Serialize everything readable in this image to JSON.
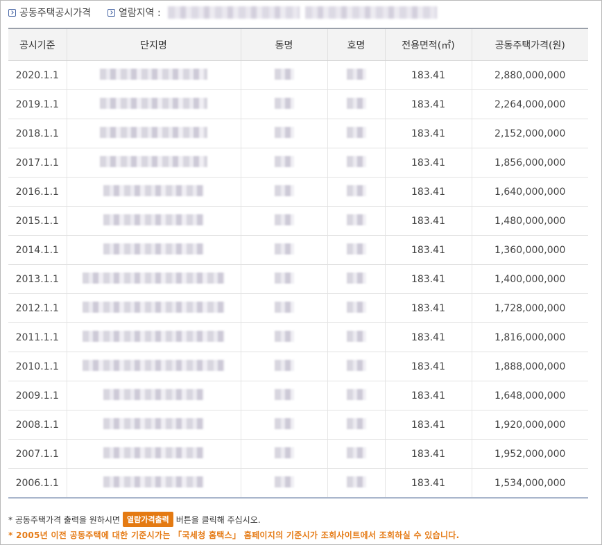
{
  "header": {
    "title": "공동주택공시가격",
    "region_label": "열람지역 :"
  },
  "table": {
    "columns": [
      "공시기준",
      "단지명",
      "동명",
      "호명",
      "전용면적(㎡)",
      "공동주택가격(원)"
    ],
    "rows": [
      {
        "date": "2020.1.1",
        "area": "183.41",
        "price": "2,880,000,000"
      },
      {
        "date": "2019.1.1",
        "area": "183.41",
        "price": "2,264,000,000"
      },
      {
        "date": "2018.1.1",
        "area": "183.41",
        "price": "2,152,000,000"
      },
      {
        "date": "2017.1.1",
        "area": "183.41",
        "price": "1,856,000,000"
      },
      {
        "date": "2016.1.1",
        "area": "183.41",
        "price": "1,640,000,000"
      },
      {
        "date": "2015.1.1",
        "area": "183.41",
        "price": "1,480,000,000"
      },
      {
        "date": "2014.1.1",
        "area": "183.41",
        "price": "1,360,000,000"
      },
      {
        "date": "2013.1.1",
        "area": "183.41",
        "price": "1,400,000,000"
      },
      {
        "date": "2012.1.1",
        "area": "183.41",
        "price": "1,728,000,000"
      },
      {
        "date": "2011.1.1",
        "area": "183.41",
        "price": "1,816,000,000"
      },
      {
        "date": "2010.1.1",
        "area": "183.41",
        "price": "1,888,000,000"
      },
      {
        "date": "2009.1.1",
        "area": "183.41",
        "price": "1,648,000,000"
      },
      {
        "date": "2008.1.1",
        "area": "183.41",
        "price": "1,920,000,000"
      },
      {
        "date": "2007.1.1",
        "area": "183.41",
        "price": "1,952,000,000"
      },
      {
        "date": "2006.1.1",
        "area": "183.41",
        "price": "1,534,000,000"
      }
    ]
  },
  "notes": {
    "print_prefix": "* 공동주택가격 출력을 원하시면",
    "print_button": "열람가격출력",
    "print_suffix": "버튼을 클릭해 주십시오.",
    "pre2005": "* 2005년 이전 공동주택에 대한 기준시가는 「국세청 홈택스」 홈페이지의 기준시가 조회사이트에서 조회하실 수 있습니다."
  },
  "colors": {
    "accent_orange": "#e47a12",
    "header_bg": "#f3f3f3",
    "icon_blue": "#4a68a6"
  }
}
